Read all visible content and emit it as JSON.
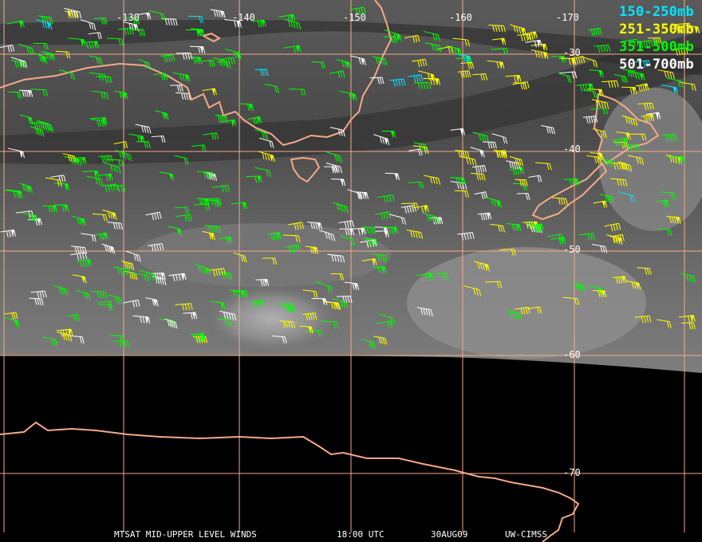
{
  "legend": [
    {
      "label": "150-250mb",
      "color": "#00e5ff"
    },
    {
      "label": "251-350mb",
      "color": "#ffff00"
    },
    {
      "label": "351-500mb",
      "color": "#00ff00"
    },
    {
      "label": "501-700mb",
      "color": "#ffffff"
    }
  ],
  "longitude_labels": [
    "-130",
    "-140",
    "-150",
    "-160",
    "-170"
  ],
  "latitude_labels": [
    "-30",
    "-40",
    "-50",
    "-60",
    "-70"
  ],
  "footer": {
    "product": "MTSAT MID-UPPER LEVEL WINDS",
    "time": "18:00 UTC",
    "date": "30AUG09",
    "source": "UW-CIMSS"
  },
  "colors": {
    "grid": "#f4a987",
    "coastline": "#f4a987",
    "background": "#000000"
  }
}
